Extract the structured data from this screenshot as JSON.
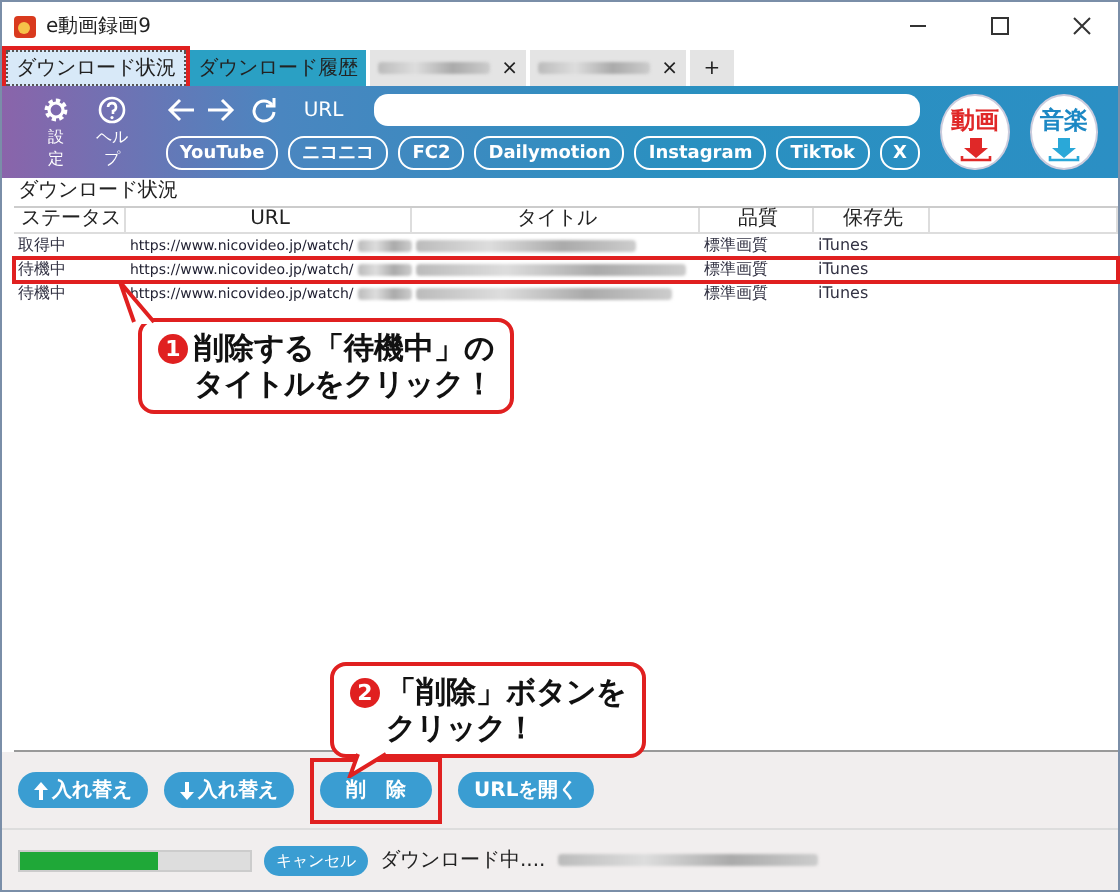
{
  "window": {
    "title": "e動画録画9"
  },
  "tabs": [
    {
      "kind": "label",
      "label": "ダウンロード状況",
      "selected": true,
      "highlighted": true
    },
    {
      "kind": "label",
      "label": "ダウンロード履歴",
      "selected": false,
      "highlighted": false
    },
    {
      "kind": "blurred",
      "close": "×",
      "selected": false,
      "highlighted": false
    },
    {
      "kind": "blurred",
      "close": "×",
      "selected": false,
      "highlighted": false
    },
    {
      "kind": "add",
      "label": "+",
      "selected": false,
      "highlighted": false
    }
  ],
  "toolbar": {
    "settings": "設定",
    "help": "ヘルプ",
    "url_label": "URL",
    "sites": [
      "YouTube",
      "ニコニコ",
      "FC2",
      "Dailymotion",
      "Instagram",
      "TikTok",
      "X"
    ],
    "video_button": "動画",
    "music_button": "音楽"
  },
  "section_title": "ダウンロード状況",
  "table": {
    "columns": [
      "ステータス",
      "URL",
      "タイトル",
      "品質",
      "保存先"
    ],
    "rows": [
      {
        "status": "取得中",
        "url": "https://www.nicovideo.jp/watch/",
        "quality": "標準画質",
        "destination": "iTunes",
        "highlighted": false
      },
      {
        "status": "待機中",
        "url": "https://www.nicovideo.jp/watch/",
        "quality": "標準画質",
        "destination": "iTunes",
        "highlighted": true
      },
      {
        "status": "待機中",
        "url": "https://www.nicovideo.jp/watch/",
        "quality": "標準画質",
        "destination": "iTunes",
        "highlighted": false
      }
    ]
  },
  "buttons": [
    {
      "kind": "up",
      "label": "入れ替え",
      "highlighted": false
    },
    {
      "kind": "down",
      "label": "入れ替え",
      "highlighted": false
    },
    {
      "kind": "plain",
      "label": "削　除",
      "highlighted": true
    },
    {
      "kind": "plain",
      "label": "URLを開く",
      "highlighted": false
    }
  ],
  "status_bar": {
    "level": 0.6,
    "cancel": "キャンセル",
    "message": "ダウンロード中...."
  },
  "callouts": [
    {
      "number": "1",
      "lines": [
        "削除する「待機中」の",
        "タイトルをクリック！"
      ]
    },
    {
      "number": "2",
      "lines": [
        "「削除」ボタンを",
        "クリック！"
      ]
    }
  ]
}
